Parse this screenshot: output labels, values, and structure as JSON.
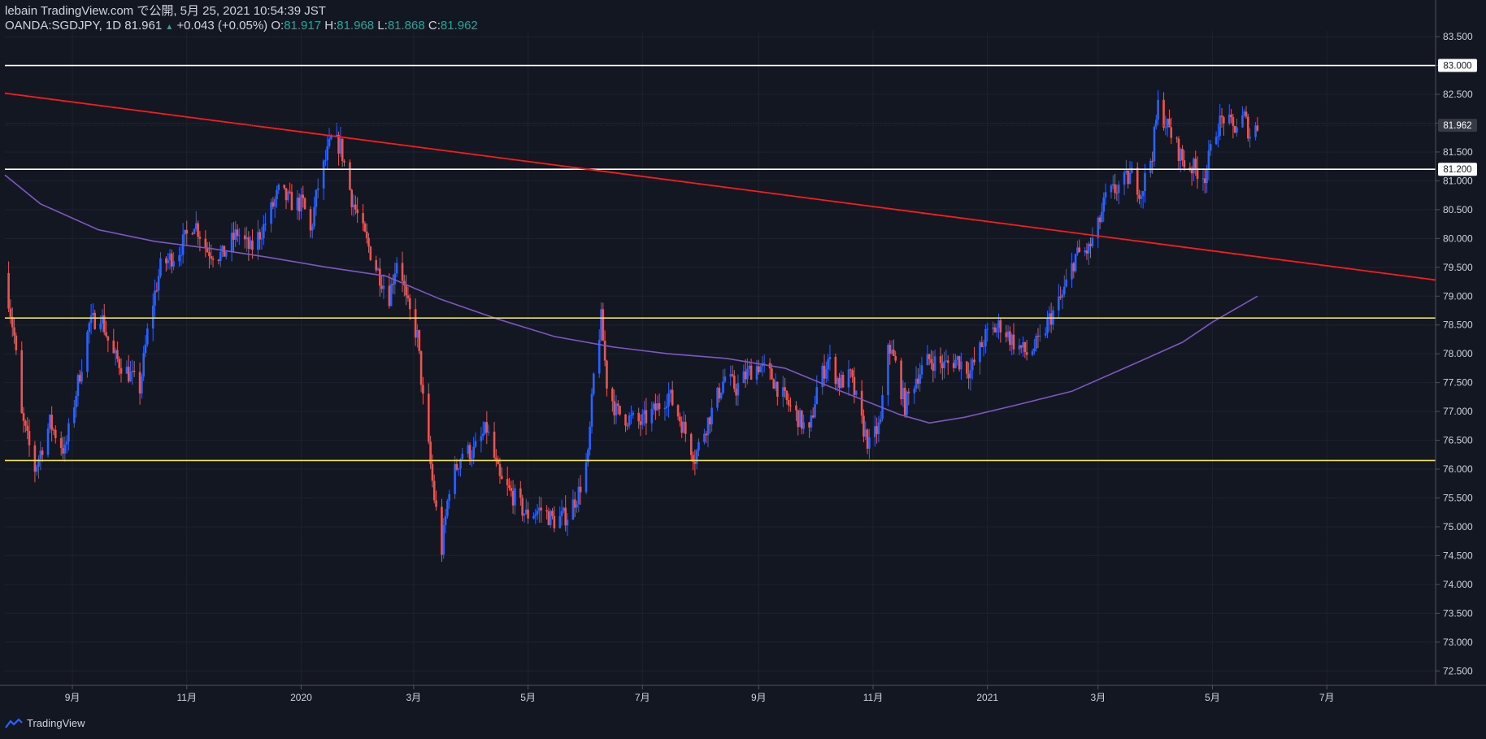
{
  "header": {
    "publisher_line": "lebain TradingView.com で公開, 5月 25, 2021 10:54:39 JST",
    "symbol": "OANDA:SGDJPY, 1D",
    "last": "81.961",
    "arrow": "▲",
    "change": "+0.043 (+0.05%)",
    "o_label": "O:",
    "o_value": "81.917",
    "h_label": "H:",
    "h_value": "81.968",
    "l_label": "L:",
    "l_value": "81.868",
    "c_label": "C:",
    "c_value": "81.962"
  },
  "footer": {
    "brand": "TradingView"
  },
  "colors": {
    "background": "#131722",
    "up": "#2962ff",
    "down": "#ef5350",
    "ma": "#7e57c2",
    "trendline": "#ff1a1a",
    "support": "#f5e63b",
    "level": "#ffffff",
    "text": "#d1d4dc",
    "grid": "#1e2230"
  },
  "chart_data": {
    "type": "candlestick",
    "symbol": "OANDA:SGDJPY",
    "interval": "1D",
    "ylim": [
      72.25,
      83.6
    ],
    "y_ticks": [
      "72.500",
      "73.000",
      "73.500",
      "74.000",
      "74.500",
      "75.000",
      "75.500",
      "76.000",
      "76.500",
      "77.000",
      "77.500",
      "78.000",
      "78.500",
      "79.000",
      "79.500",
      "80.000",
      "80.500",
      "81.000",
      "81.500",
      "82.000",
      "82.500",
      "83.000",
      "83.500"
    ],
    "x_ticks": [
      {
        "label": "9月",
        "date": "2019-09-01"
      },
      {
        "label": "11月",
        "date": "2019-11-01"
      },
      {
        "label": "2020",
        "date": "2020-01-01"
      },
      {
        "label": "3月",
        "date": "2020-03-01"
      },
      {
        "label": "5月",
        "date": "2020-05-01"
      },
      {
        "label": "7月",
        "date": "2020-07-01"
      },
      {
        "label": "9月",
        "date": "2020-09-01"
      },
      {
        "label": "11月",
        "date": "2020-11-01"
      },
      {
        "label": "2021",
        "date": "2021-01-01"
      },
      {
        "label": "3月",
        "date": "2021-03-01"
      },
      {
        "label": "5月",
        "date": "2021-05-01"
      },
      {
        "label": "7月",
        "date": "2021-07-01"
      }
    ],
    "x_range": [
      "2019-07-27",
      "2021-08-28"
    ],
    "price_path": [
      [
        "2019-07-27",
        79.4
      ],
      [
        "2019-08-01",
        78.3
      ],
      [
        "2019-08-05",
        76.9
      ],
      [
        "2019-08-12",
        76.0
      ],
      [
        "2019-08-20",
        76.8
      ],
      [
        "2019-08-28",
        76.3
      ],
      [
        "2019-09-04",
        77.5
      ],
      [
        "2019-09-10",
        78.5
      ],
      [
        "2019-09-16",
        78.7
      ],
      [
        "2019-09-22",
        78.0
      ],
      [
        "2019-09-30",
        77.7
      ],
      [
        "2019-10-07",
        77.4
      ],
      [
        "2019-10-12",
        78.6
      ],
      [
        "2019-10-18",
        79.5
      ],
      [
        "2019-10-28",
        79.8
      ],
      [
        "2019-11-05",
        80.3
      ],
      [
        "2019-11-12",
        79.8
      ],
      [
        "2019-11-20",
        79.7
      ],
      [
        "2019-11-28",
        80.1
      ],
      [
        "2019-12-05",
        79.8
      ],
      [
        "2019-12-12",
        80.2
      ],
      [
        "2019-12-20",
        80.8
      ],
      [
        "2019-12-28",
        80.6
      ],
      [
        "2020-01-02",
        80.6
      ],
      [
        "2020-01-06",
        80.1
      ],
      [
        "2020-01-10",
        80.9
      ],
      [
        "2020-01-17",
        81.7
      ],
      [
        "2020-01-22",
        81.6
      ],
      [
        "2020-01-28",
        80.7
      ],
      [
        "2020-02-03",
        80.1
      ],
      [
        "2020-02-10",
        79.5
      ],
      [
        "2020-02-17",
        79.0
      ],
      [
        "2020-02-22",
        79.8
      ],
      [
        "2020-02-26",
        78.9
      ],
      [
        "2020-03-03",
        78.3
      ],
      [
        "2020-03-06",
        77.2
      ],
      [
        "2020-03-12",
        75.5
      ],
      [
        "2020-03-16",
        74.6
      ],
      [
        "2020-03-20",
        75.7
      ],
      [
        "2020-03-27",
        76.3
      ],
      [
        "2020-04-02",
        76.3
      ],
      [
        "2020-04-09",
        76.7
      ],
      [
        "2020-04-16",
        75.8
      ],
      [
        "2020-04-24",
        75.5
      ],
      [
        "2020-04-30",
        75.2
      ],
      [
        "2020-05-08",
        75.3
      ],
      [
        "2020-05-15",
        75.1
      ],
      [
        "2020-05-22",
        75.2
      ],
      [
        "2020-05-28",
        75.6
      ],
      [
        "2020-06-02",
        76.2
      ],
      [
        "2020-06-05",
        77.6
      ],
      [
        "2020-06-09",
        78.6
      ],
      [
        "2020-06-12",
        77.5
      ],
      [
        "2020-06-17",
        77.0
      ],
      [
        "2020-06-22",
        76.9
      ],
      [
        "2020-06-30",
        76.8
      ],
      [
        "2020-07-07",
        77.0
      ],
      [
        "2020-07-15",
        77.3
      ],
      [
        "2020-07-22",
        76.8
      ],
      [
        "2020-07-29",
        76.2
      ],
      [
        "2020-08-02",
        76.6
      ],
      [
        "2020-08-07",
        77.0
      ],
      [
        "2020-08-14",
        77.6
      ],
      [
        "2020-08-20",
        77.4
      ],
      [
        "2020-08-27",
        77.7
      ],
      [
        "2020-09-01",
        77.8
      ],
      [
        "2020-09-08",
        77.6
      ],
      [
        "2020-09-15",
        77.2
      ],
      [
        "2020-09-22",
        76.9
      ],
      [
        "2020-09-28",
        76.6
      ],
      [
        "2020-10-02",
        77.4
      ],
      [
        "2020-10-08",
        77.9
      ],
      [
        "2020-10-14",
        77.5
      ],
      [
        "2020-10-20",
        77.6
      ],
      [
        "2020-10-26",
        76.8
      ],
      [
        "2020-10-30",
        76.4
      ],
      [
        "2020-11-05",
        76.8
      ],
      [
        "2020-11-09",
        78.2
      ],
      [
        "2020-11-13",
        77.8
      ],
      [
        "2020-11-18",
        77.1
      ],
      [
        "2020-11-24",
        77.6
      ],
      [
        "2020-12-01",
        77.9
      ],
      [
        "2020-12-09",
        77.8
      ],
      [
        "2020-12-16",
        77.9
      ],
      [
        "2020-12-23",
        77.7
      ],
      [
        "2020-12-31",
        78.3
      ],
      [
        "2021-01-08",
        78.5
      ],
      [
        "2021-01-15",
        78.2
      ],
      [
        "2021-01-22",
        78.0
      ],
      [
        "2021-01-29",
        78.2
      ],
      [
        "2021-02-03",
        78.6
      ],
      [
        "2021-02-10",
        79.0
      ],
      [
        "2021-02-17",
        79.7
      ],
      [
        "2021-02-24",
        79.8
      ],
      [
        "2021-03-01",
        80.2
      ],
      [
        "2021-03-05",
        80.7
      ],
      [
        "2021-03-12",
        80.9
      ],
      [
        "2021-03-19",
        81.1
      ],
      [
        "2021-03-24",
        80.8
      ],
      [
        "2021-03-30",
        81.5
      ],
      [
        "2021-04-02",
        82.3
      ],
      [
        "2021-04-09",
        81.8
      ],
      [
        "2021-04-16",
        81.3
      ],
      [
        "2021-04-22",
        81.2
      ],
      [
        "2021-04-27",
        81.1
      ],
      [
        "2021-05-03",
        81.9
      ],
      [
        "2021-05-07",
        82.1
      ],
      [
        "2021-05-12",
        81.9
      ],
      [
        "2021-05-18",
        82.1
      ],
      [
        "2021-05-21",
        81.8
      ],
      [
        "2021-05-25",
        81.96
      ]
    ],
    "ma_path": [
      [
        "2019-07-27",
        81.1
      ],
      [
        "2019-08-15",
        80.6
      ],
      [
        "2019-09-15",
        80.15
      ],
      [
        "2019-10-15",
        79.95
      ],
      [
        "2019-11-15",
        79.82
      ],
      [
        "2019-12-15",
        79.67
      ],
      [
        "2020-01-15",
        79.5
      ],
      [
        "2020-02-15",
        79.35
      ],
      [
        "2020-03-15",
        78.95
      ],
      [
        "2020-04-15",
        78.6
      ],
      [
        "2020-05-15",
        78.3
      ],
      [
        "2020-06-15",
        78.12
      ],
      [
        "2020-07-15",
        78.0
      ],
      [
        "2020-08-15",
        77.92
      ],
      [
        "2020-09-15",
        77.75
      ],
      [
        "2020-10-15",
        77.35
      ],
      [
        "2020-11-15",
        76.95
      ],
      [
        "2020-12-01",
        76.8
      ],
      [
        "2020-12-20",
        76.9
      ],
      [
        "2021-01-15",
        77.1
      ],
      [
        "2021-02-15",
        77.35
      ],
      [
        "2021-03-15",
        77.75
      ],
      [
        "2021-04-15",
        78.2
      ],
      [
        "2021-05-01",
        78.55
      ],
      [
        "2021-05-25",
        79.0
      ]
    ],
    "ma_label": "",
    "trendline": {
      "from": [
        "2019-07-27",
        82.52
      ],
      "to": [
        "2021-08-28",
        79.28
      ]
    },
    "horizontal_lines": [
      {
        "kind": "level",
        "price": 83.0,
        "label": "83.000"
      },
      {
        "kind": "level",
        "price": 81.2,
        "label": "81.200"
      },
      {
        "kind": "support",
        "price": 78.62,
        "label": ""
      },
      {
        "kind": "support",
        "price": 76.15,
        "label": ""
      }
    ],
    "current_price": 81.962,
    "current_price_label": "81.962",
    "grid": true,
    "legend": "none"
  }
}
